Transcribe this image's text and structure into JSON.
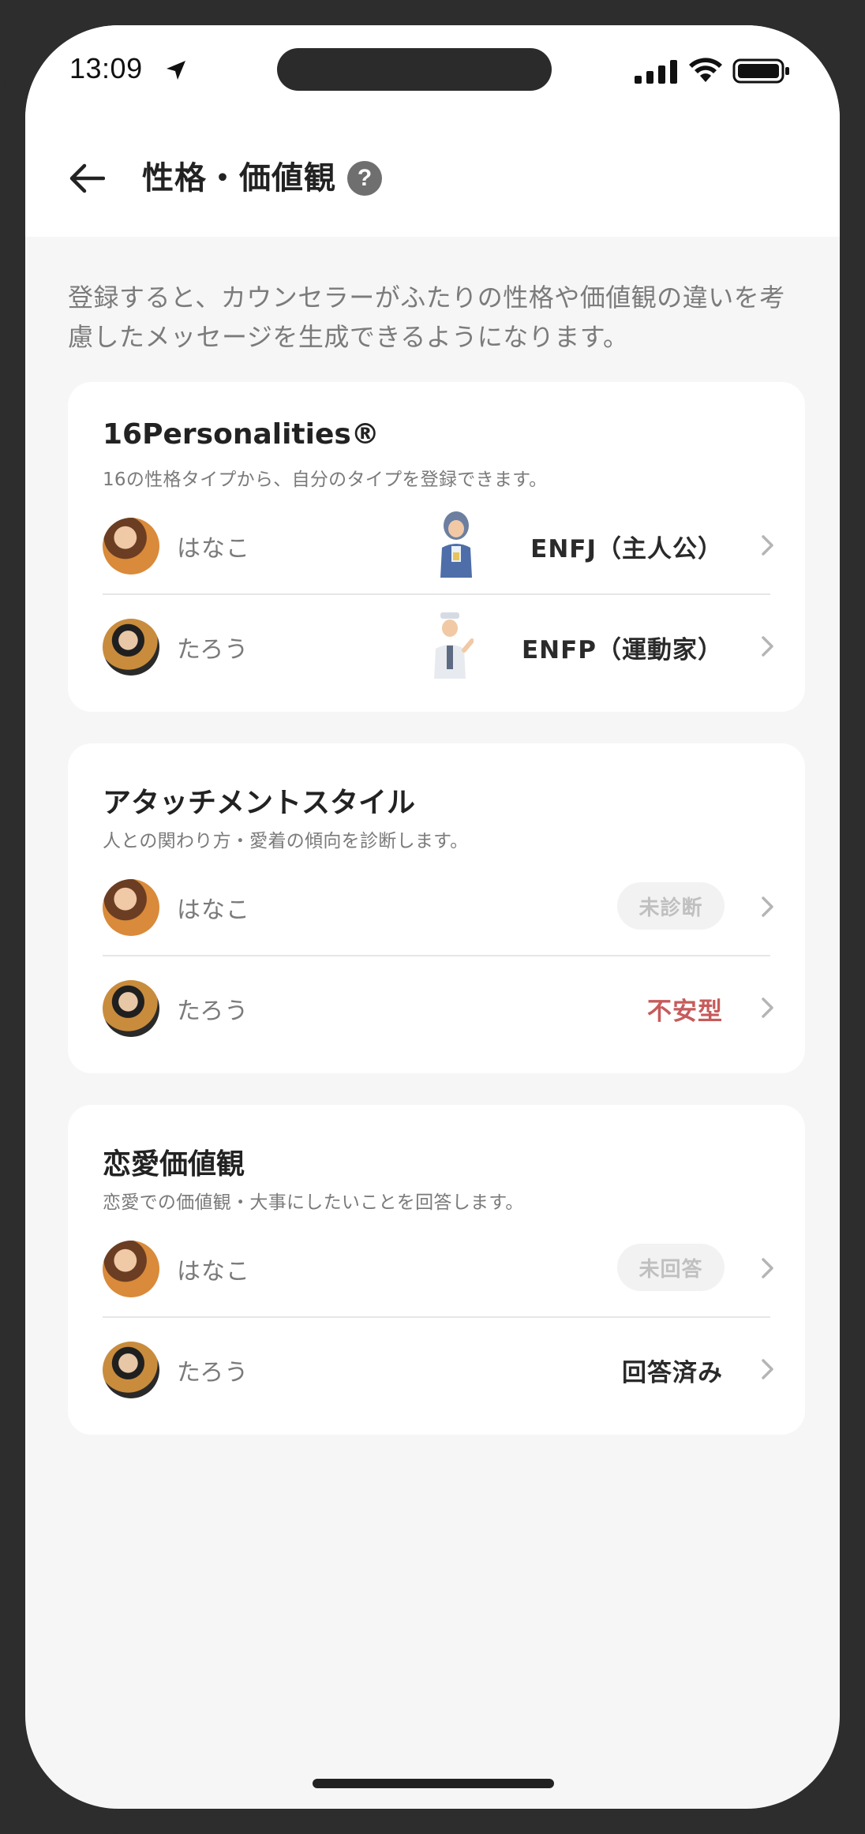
{
  "status_bar": {
    "time": "13:09"
  },
  "header": {
    "title": "性格・価値観",
    "help_symbol": "?"
  },
  "intro_text": "登録すると、カウンセラーがふたりの性格や価値観の違いを考慮したメッセージを生成できるようになります。",
  "cards": [
    {
      "title": "16Personalities®",
      "subtitle": "16の性格タイプから、自分のタイプを登録できます。",
      "rows": [
        {
          "name": "はなこ",
          "value": "ENFJ（主人公）"
        },
        {
          "name": "たろう",
          "value": "ENFP（運動家）"
        }
      ]
    },
    {
      "title": "アタッチメントスタイル",
      "subtitle": "人との関わり方・愛着の傾向を診断します。",
      "rows": [
        {
          "name": "はなこ",
          "value": "未診断"
        },
        {
          "name": "たろう",
          "value": "不安型"
        }
      ]
    },
    {
      "title": "恋愛価値観",
      "subtitle": "恋愛での価値観・大事にしたいことを回答します。",
      "rows": [
        {
          "name": "はなこ",
          "value": "未回答"
        },
        {
          "name": "たろう",
          "value": "回答済み"
        }
      ]
    }
  ],
  "colors": {
    "accent_red": "#c75b5b",
    "background": "#f6f6f6",
    "card": "#ffffff",
    "muted_text": "#7a7a7a"
  },
  "icons": {
    "back": "arrow-left-icon",
    "help": "question-circle-icon",
    "chevron": "chevron-right-icon",
    "protagonist": "enfj-protagonist-icon",
    "campaigner": "enfp-campaigner-icon"
  }
}
